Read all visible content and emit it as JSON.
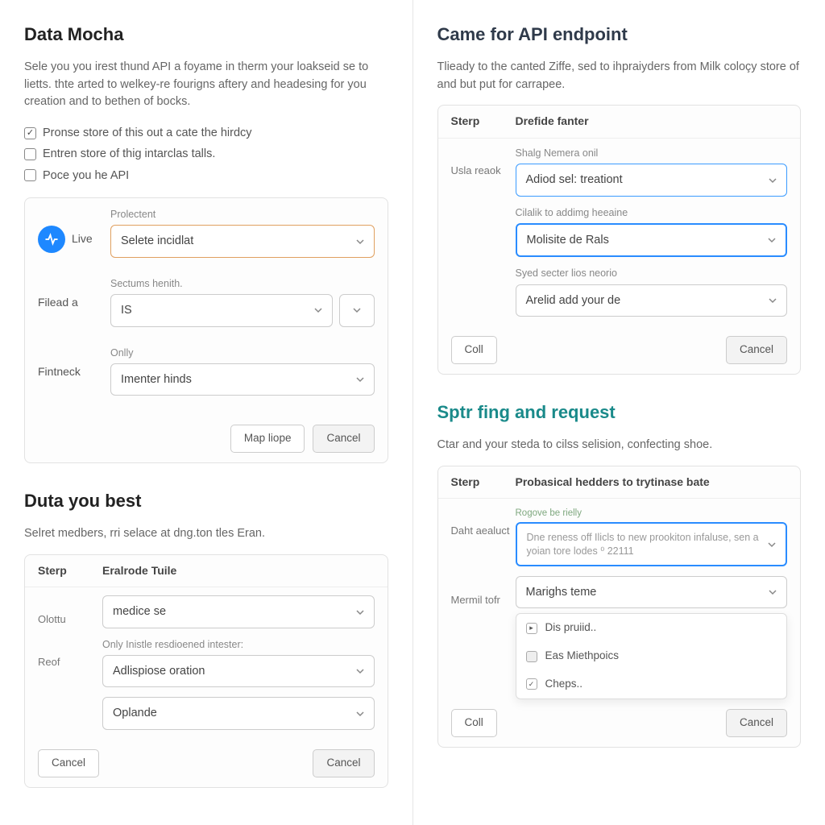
{
  "left": {
    "section1": {
      "title": "Data Mocha",
      "desc": "Sele you you irest thund API a foyame in therm your loakseid se to lietts. thte arted to welkey-re fourigns aftery and headesing for you creation and to bethen of bocks.",
      "checks": [
        {
          "label": "Pronse store of this out a cate the hirdcy",
          "checked": true
        },
        {
          "label": "Entren store of thig intarclas talls.",
          "checked": false
        },
        {
          "label": "Poce you he API",
          "checked": false
        }
      ],
      "card": {
        "side_live": "Live",
        "side_filead": "Filead a",
        "side_fintneck": "Fintneck",
        "f1_label": "Prolectent",
        "f1_value": "Selete incidlat",
        "f2_label": "Sectums henith.",
        "f2_value": "IS",
        "f3_label": "Onlly",
        "f3_value": "Imenter hinds",
        "btn_primary": "Map liope",
        "btn_cancel": "Cancel"
      }
    },
    "section2": {
      "title": "Duta you best",
      "desc": "Selret medbers, rri selace at dng.ton tles Eran.",
      "card": {
        "head_c1": "Sterp",
        "head_c2": "Eralrode Tuile",
        "side1": "Olottu",
        "side2": "Reof",
        "f1_value": "medice se",
        "f2_label": "Only Inistle resdioened intester:",
        "f2_value": "Adlispiose oration",
        "f3_value": "Oplande",
        "btn_left": "Cancel",
        "btn_right": "Cancel"
      }
    }
  },
  "right": {
    "section1": {
      "title": "Came for API endpoint",
      "desc": "Tlieady to the canted Ziffe, sed to ihpraiyders from Milk coloçy store of and but put for carrapee.",
      "card": {
        "head_c1": "Sterp",
        "head_c2": "Drefide fanter",
        "side1": "Usla reaok",
        "f1_label": "Shalg Nemera onil",
        "f1_value": "Adiod sel: treationt",
        "f2_label": "Cilalik to addimg heeaine",
        "f2_value": "Molisite de Rals",
        "f3_label": "Syed secter lios neorio",
        "f3_value": "Arelid add your de",
        "btn_left": "Coll",
        "btn_right": "Cancel"
      }
    },
    "section2": {
      "title": "Sptr fing and request",
      "desc": "Ctar and your steda to cilss selision, confecting shoe.",
      "card": {
        "head_c1": "Sterp",
        "head_c2": "Probasical hedders to trytinase bate",
        "side1": "Daht aealuct",
        "side2": "Mermil tofr",
        "f1_tiny": "Rogove be rielly",
        "f1_value": "Dne reness off Ilicls to new prookiton infaluse, sen a yoian tore lodes ⁰ 22111",
        "f2_value": "Marighs teme",
        "dd_items": [
          {
            "icon": "arrow",
            "label": "Dis pruiid.."
          },
          {
            "icon": "square",
            "label": "Eas Miethpoics"
          },
          {
            "icon": "check",
            "label": "Cheps.."
          }
        ],
        "btn_left": "Coll",
        "btn_right": "Cancel"
      }
    }
  }
}
